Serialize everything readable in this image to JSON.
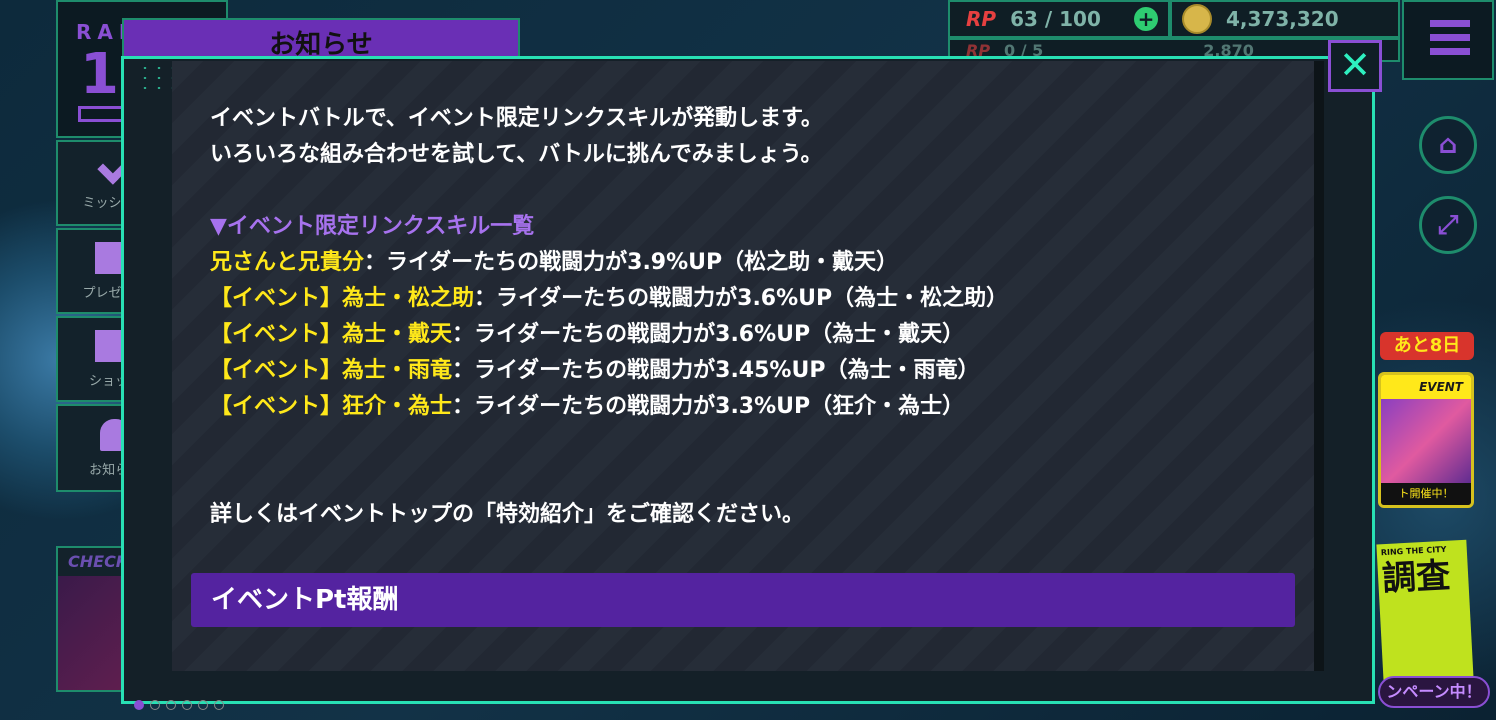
{
  "status_bar": {
    "rp_label": "RP",
    "rp_value": "63 / 100",
    "coins": "4,373,320",
    "row2_value": "0 / 5",
    "row2_coins": "2,870"
  },
  "left_menu": {
    "rank_label": "RANK",
    "rank_value": "1",
    "items": [
      {
        "label": "ミッション"
      },
      {
        "label": "プレゼント"
      },
      {
        "label": "ショップ"
      },
      {
        "label": "お知らせ"
      }
    ],
    "check_label": "CHECK"
  },
  "notice_tab": {
    "title": "お知らせ"
  },
  "modal": {
    "close_symbol": "✕",
    "intro_lines": [
      "イベントバトルで、イベント限定リンクスキルが発動します。",
      "いろいろな組み合わせを試して、バトルに挑んでみましょう。"
    ],
    "list_heading": "▼イベント限定リンクスキル一覧",
    "skills": [
      {
        "name": "兄さんと兄貴分",
        "desc": "：ライダーたちの戦闘力が3.9%UP（松之助・戴天）"
      },
      {
        "name": "【イベント】為士・松之助",
        "desc": "：ライダーたちの戦闘力が3.6%UP（為士・松之助）"
      },
      {
        "name": "【イベント】為士・戴天",
        "desc": "：ライダーたちの戦闘力が3.6%UP（為士・戴天）"
      },
      {
        "name": "【イベント】為士・雨竜",
        "desc": "：ライダーたちの戦闘力が3.45%UP（為士・雨竜）"
      },
      {
        "name": "【イベント】狂介・為士",
        "desc": "：ライダーたちの戦闘力が3.3%UP（狂介・為士）"
      }
    ],
    "footer_note": "詳しくはイベントトップの「特効紹介」をご確認ください。",
    "section_header": "イベントPt報酬"
  },
  "right_side": {
    "days_left_badge": "あと8日",
    "event_banner_label": "EVENT",
    "event_banner_footer": "ト開催中！",
    "campaign_top": "RING THE CITY",
    "campaign_big": "調査",
    "campaign_pill": "ンペーン中！"
  },
  "colors": {
    "accent_teal": "#28e0b4",
    "accent_purple": "#5423a0",
    "skill_name_yellow": "#ffe81a",
    "heading_purple": "#a772ee"
  }
}
